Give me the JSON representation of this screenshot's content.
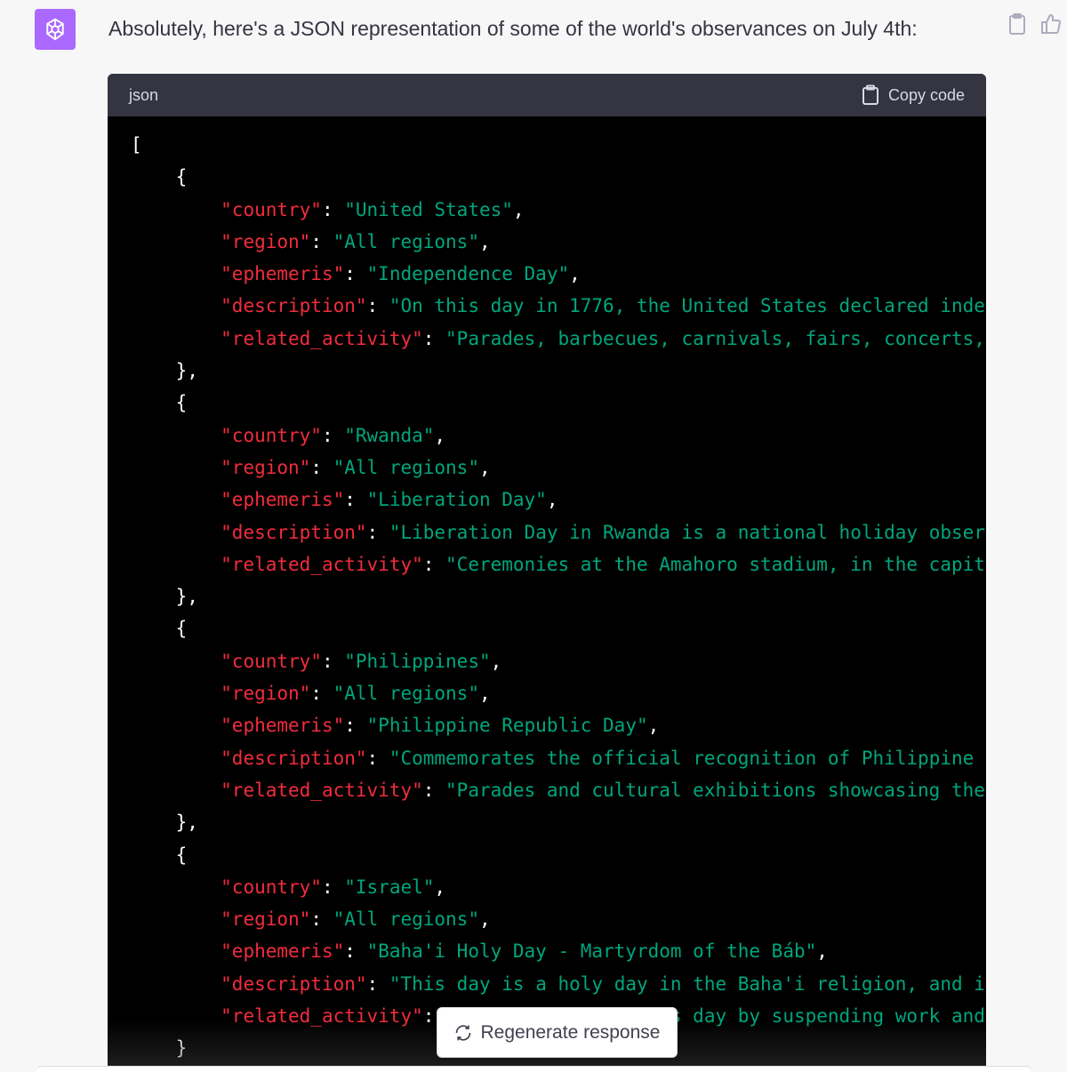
{
  "message": {
    "intro": "Absolutely, here's a JSON representation of some of the world's observances on July 4th:"
  },
  "code": {
    "language": "json",
    "copy_label": "Copy code",
    "lines": [
      [
        "[",
        ""
      ],
      [
        "    {",
        ""
      ],
      [
        "        \"country\"",
        ": ",
        "\"United States\"",
        ","
      ],
      [
        "        \"region\"",
        ": ",
        "\"All regions\"",
        ","
      ],
      [
        "        \"ephemeris\"",
        ": ",
        "\"Independence Day\"",
        ","
      ],
      [
        "        \"description\"",
        ": ",
        "\"On this day in 1776, the United States declared inde",
        ""
      ],
      [
        "        \"related_activity\"",
        ": ",
        "\"Parades, barbecues, carnivals, fairs, concerts,",
        ""
      ],
      [
        "    },",
        ""
      ],
      [
        "    {",
        ""
      ],
      [
        "        \"country\"",
        ": ",
        "\"Rwanda\"",
        ","
      ],
      [
        "        \"region\"",
        ": ",
        "\"All regions\"",
        ","
      ],
      [
        "        \"ephemeris\"",
        ": ",
        "\"Liberation Day\"",
        ","
      ],
      [
        "        \"description\"",
        ": ",
        "\"Liberation Day in Rwanda is a national holiday obser",
        ""
      ],
      [
        "        \"related_activity\"",
        ": ",
        "\"Ceremonies at the Amahoro stadium, in the capit",
        ""
      ],
      [
        "    },",
        ""
      ],
      [
        "    {",
        ""
      ],
      [
        "        \"country\"",
        ": ",
        "\"Philippines\"",
        ","
      ],
      [
        "        \"region\"",
        ": ",
        "\"All regions\"",
        ","
      ],
      [
        "        \"ephemeris\"",
        ": ",
        "\"Philippine Republic Day\"",
        ","
      ],
      [
        "        \"description\"",
        ": ",
        "\"Commemorates the official recognition of Philippine",
        ""
      ],
      [
        "        \"related_activity\"",
        ": ",
        "\"Parades and cultural exhibitions showcasing the",
        ""
      ],
      [
        "    },",
        ""
      ],
      [
        "    {",
        ""
      ],
      [
        "        \"country\"",
        ": ",
        "\"Israel\"",
        ","
      ],
      [
        "        \"region\"",
        ": ",
        "\"All regions\"",
        ","
      ],
      [
        "        \"ephemeris\"",
        ": ",
        "\"Baha'i Holy Day - Martyrdom of the Báb\"",
        ","
      ],
      [
        "        \"description\"",
        ": ",
        "\"This day is a holy day in the Baha'i religion, and i",
        ""
      ],
      [
        "        \"related_activity\"",
        ": ",
        "\"Baha'is observe this day by suspending work and",
        ""
      ],
      [
        "    }",
        ""
      ]
    ]
  },
  "regenerate_label": "Regenerate response",
  "colors": {
    "key": "#f22c3d",
    "string": "#00a67d",
    "avatar": "#ab68ff"
  }
}
